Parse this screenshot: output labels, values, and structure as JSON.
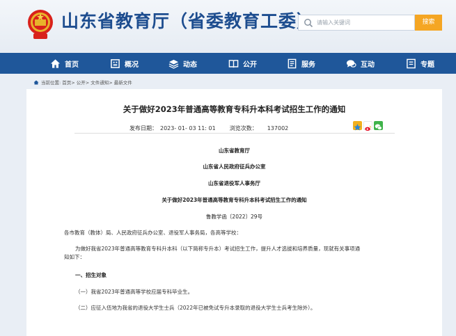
{
  "header": {
    "site_title": "山东省教育厅（省委教育工委）",
    "search_placeholder": "请输入关键词",
    "search_button": "搜索"
  },
  "nav": {
    "items": [
      {
        "label": "首页",
        "icon": "home-icon"
      },
      {
        "label": "概况",
        "icon": "building-icon"
      },
      {
        "label": "动态",
        "icon": "layers-icon"
      },
      {
        "label": "公开",
        "icon": "book-icon"
      },
      {
        "label": "服务",
        "icon": "document-icon"
      },
      {
        "label": "互动",
        "icon": "chat-icon"
      },
      {
        "label": "专题",
        "icon": "list-icon"
      }
    ]
  },
  "breadcrumb": "当前位置: 首页> 公开> 文件通知> 最新文件",
  "article": {
    "title": "关于做好2023年普通高等教育专科升本科考试招生工作的通知",
    "publish_label": "发布日期：",
    "publish_date": "2023- 01- 03 11: 01",
    "views_label": "浏览次数：",
    "views": "137002",
    "issuer_1": "山东省教育厅",
    "issuer_2": "山东省人民政府征兵办公室",
    "issuer_3": "山东省退役军人事务厅",
    "doc_title": "关于做好2023年普通高等教育专科升本科考试招生工作的通知",
    "doc_number": "鲁教学函〔2022〕29号",
    "salutation": "各市教育（教体）局、人民政府征兵办公室、退役军人事务局，各高等学校：",
    "intro_1": "为做好我省2023年普通高等教育专科升本科（以下简称专升本）考试招生工作，提升人才选拔和培养质量，现就有关事项通",
    "intro_2": "知如下：",
    "section_1": "一、招生对象",
    "item_1": "（一）我省2023年普通高等学校应届专科毕业生。",
    "item_2": "（二）应征入伍地为我省的退役大学生士兵（2022年已被免试专升本录取的退役大学生士兵考生除外）。"
  },
  "colors": {
    "nav_bg": "#1f579a",
    "title_blue": "#1d4d8f",
    "search_button": "#f5a623"
  }
}
